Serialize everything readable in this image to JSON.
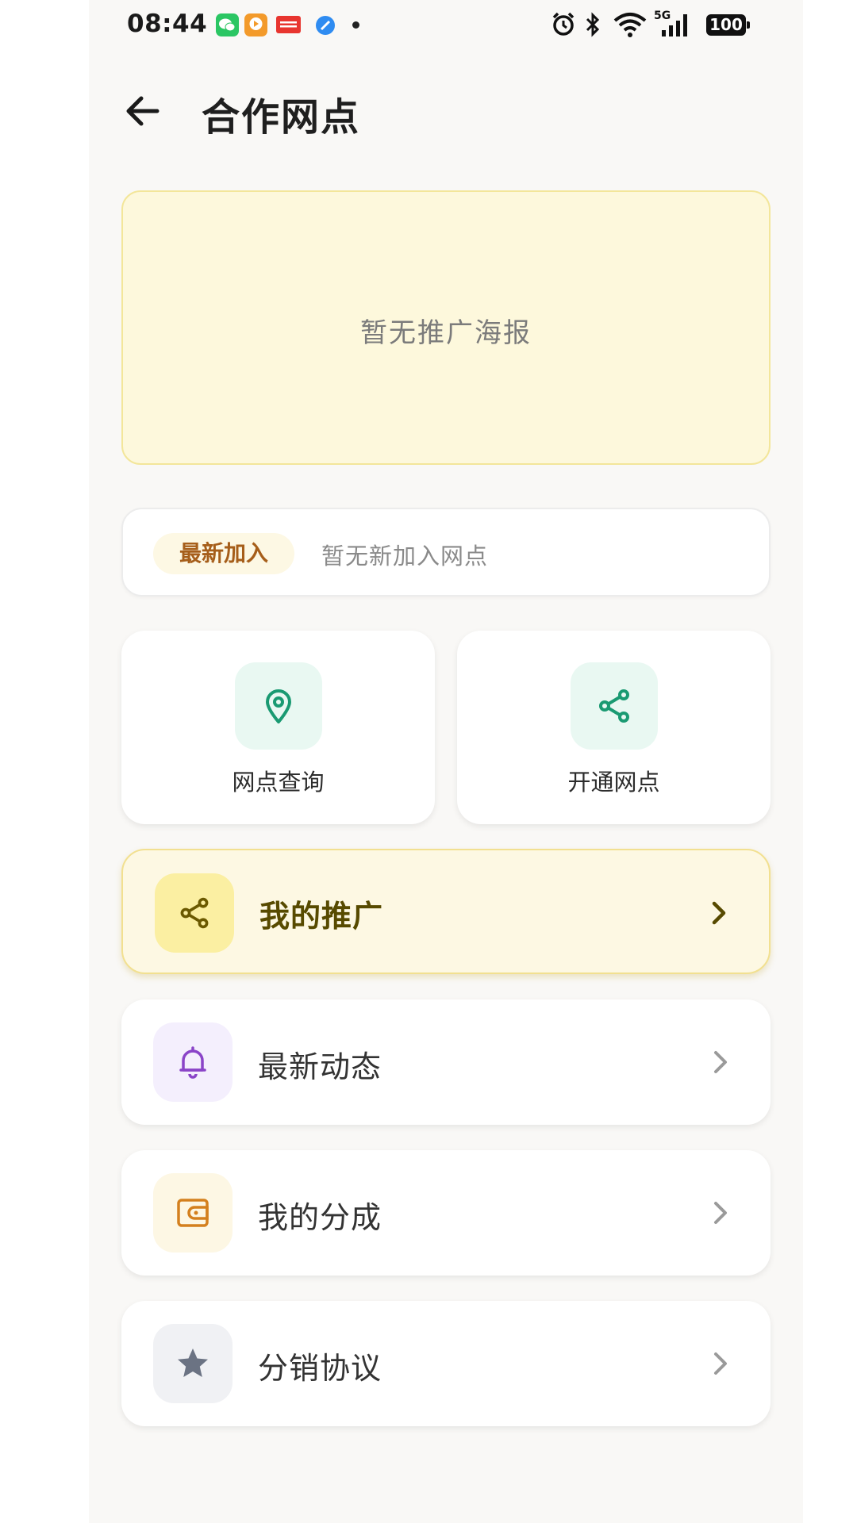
{
  "status_bar": {
    "time": "08:44",
    "apps": [
      {
        "name": "wechat-icon",
        "color": "#2bc663"
      },
      {
        "name": "video-app-icon",
        "color": "#f39a2a"
      },
      {
        "name": "toutiao-icon",
        "color": "#e8352f"
      },
      {
        "name": "browser-icon",
        "color": "#2f8cf1"
      }
    ],
    "network": "5G",
    "battery": "100"
  },
  "header": {
    "title": "合作网点"
  },
  "poster": {
    "empty_text": "暂无推广海报"
  },
  "new_join": {
    "badge": "最新加入",
    "text": "暂无新加入网点"
  },
  "grid": [
    {
      "label": "网点查询",
      "icon": "location-pin-icon",
      "color": "#1a9a72"
    },
    {
      "label": "开通网点",
      "icon": "share-icon",
      "color": "#1a9a72"
    }
  ],
  "menu": [
    {
      "label": "我的推广",
      "icon": "share-icon",
      "color": "#6b5900",
      "icon_bg": "#fbefa2",
      "highlighted": true
    },
    {
      "label": "最新动态",
      "icon": "bell-icon",
      "color": "#8a44c8",
      "icon_bg": "#f4effd",
      "highlighted": false
    },
    {
      "label": "我的分成",
      "icon": "wallet-icon",
      "color": "#d4801e",
      "icon_bg": "#fdf7e4",
      "highlighted": false
    },
    {
      "label": "分销协议",
      "icon": "star-icon",
      "color": "#6b7383",
      "icon_bg": "#f0f1f4",
      "highlighted": false
    }
  ]
}
